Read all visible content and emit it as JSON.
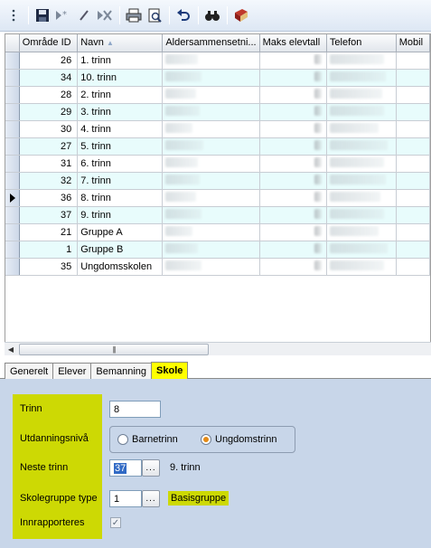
{
  "toolbar": {
    "buttons": [
      "grip-icon",
      "save-icon",
      "new-record-icon",
      "edit-icon",
      "delete-icon",
      "print-icon",
      "print-preview-icon",
      "undo-icon",
      "find-icon",
      "help-book-icon"
    ]
  },
  "grid": {
    "columns": [
      "Område ID",
      "Navn",
      "Aldersammensetni...",
      "Maks elevtall",
      "Telefon",
      "Mobil"
    ],
    "sort_indicator": "▲",
    "rows": [
      {
        "id": "26",
        "name": "1. trinn"
      },
      {
        "id": "34",
        "name": "10. trinn"
      },
      {
        "id": "28",
        "name": "2. trinn"
      },
      {
        "id": "29",
        "name": "3. trinn"
      },
      {
        "id": "30",
        "name": "4. trinn"
      },
      {
        "id": "27",
        "name": "5. trinn"
      },
      {
        "id": "31",
        "name": "6. trinn"
      },
      {
        "id": "32",
        "name": "7. trinn"
      },
      {
        "id": "36",
        "name": "8. trinn"
      },
      {
        "id": "37",
        "name": "9. trinn"
      },
      {
        "id": "21",
        "name": "Gruppe A"
      },
      {
        "id": "1",
        "name": "Gruppe B"
      },
      {
        "id": "35",
        "name": "Ungdomsskolen"
      }
    ],
    "current_row_index": 8
  },
  "tabs": [
    {
      "label": "Generelt"
    },
    {
      "label": "Elever"
    },
    {
      "label": "Bemanning"
    },
    {
      "label": "Skole"
    }
  ],
  "active_tab": "Skole",
  "form": {
    "trinn_label": "Trinn",
    "trinn_value": "8",
    "utdanningsniva_label": "Utdanningsnivå",
    "radio_barnetrinn": "Barnetrinn",
    "radio_ungdomstrinn": "Ungdomstrinn",
    "selected_radio": "Ungdomstrinn",
    "neste_trinn_label": "Neste trinn",
    "neste_trinn_value": "37",
    "neste_trinn_name": "9. trinn",
    "skolegruppe_label": "Skolegruppe type",
    "skolegruppe_value": "1",
    "skolegruppe_name": "Basisgruppe",
    "innrapporteres_label": "Innrapporteres",
    "innrapporteres_checked": true,
    "lookup_button_label": "..."
  },
  "colors": {
    "highlight_yellow": "#cdd904",
    "active_tab": "#ffff00",
    "panel_bg": "#c8d6e9",
    "row_alt": "#e8fcfc"
  }
}
